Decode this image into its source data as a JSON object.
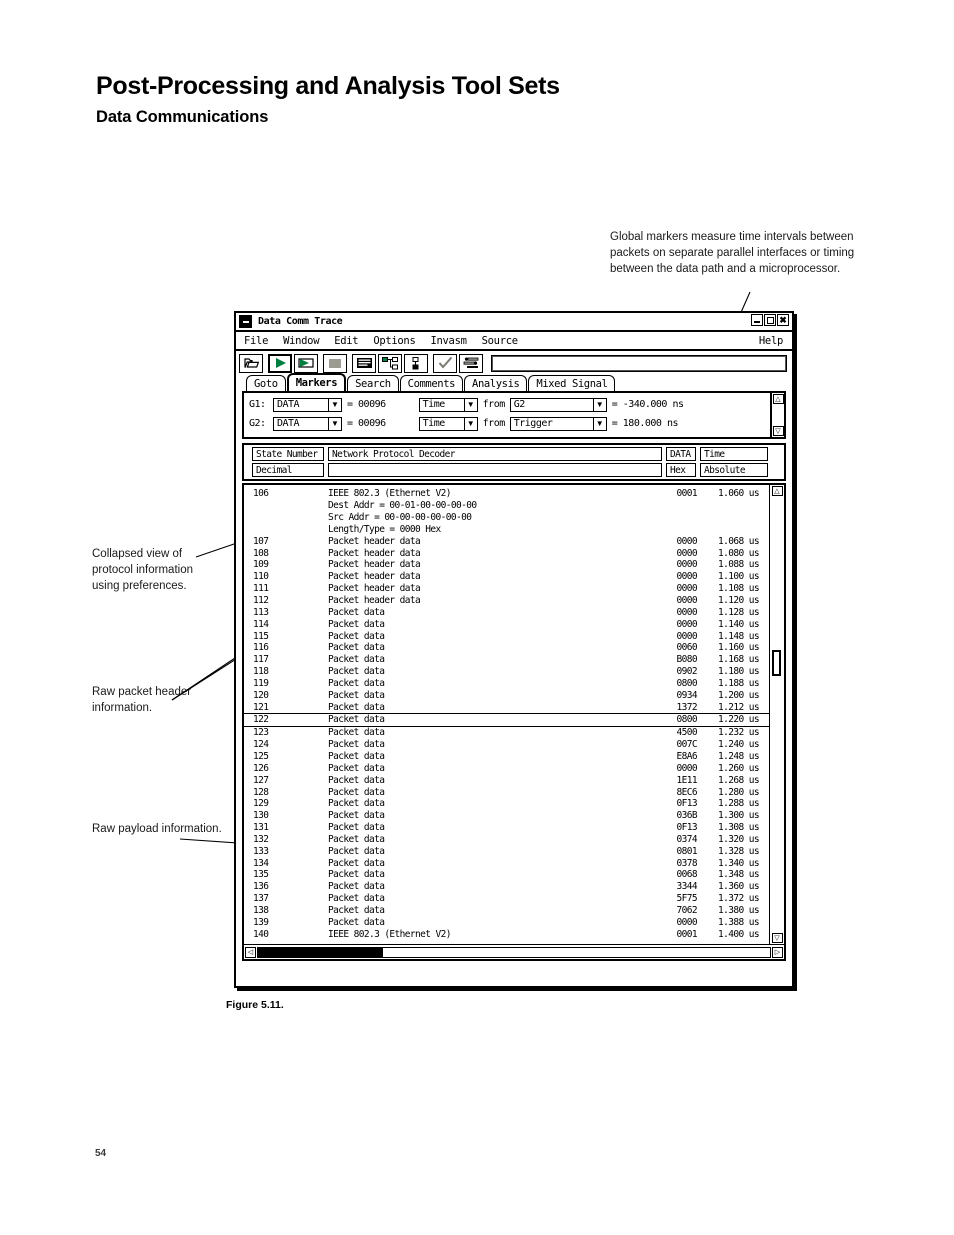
{
  "page": {
    "title": "Post-Processing and Analysis Tool Sets",
    "subtitle": "Data Communications",
    "figure_caption": "Figure 5.11.",
    "page_number": "54"
  },
  "callouts": {
    "global_markers": "Global markers measure time intervals between packets on separate parallel interfaces or timing between the data path and a microprocessor.",
    "collapsed_view": "Collapsed view of protocol information using preferences.",
    "raw_header": "Raw packet header information.",
    "raw_payload": "Raw payload information."
  },
  "window": {
    "title": "Data Comm Trace",
    "menus": [
      "File",
      "Window",
      "Edit",
      "Options",
      "Invasm",
      "Source"
    ],
    "help_label": "Help",
    "title_buttons": [
      "minimize-button",
      "maximize-button",
      "close-button"
    ],
    "toolbar_icons": [
      "open-folder-icon",
      "run-icon",
      "run-repetitive-icon",
      "stop-icon",
      "listing-icon",
      "network-tree-icon",
      "hierarchy-icon",
      "check-icon",
      "settings-sliders-icon"
    ],
    "toolbar_entry_value": ""
  },
  "tabs": [
    {
      "label": "Goto",
      "active": false
    },
    {
      "label": "Markers",
      "active": true
    },
    {
      "label": "Search",
      "active": false
    },
    {
      "label": "Comments",
      "active": false
    },
    {
      "label": "Analysis",
      "active": false
    },
    {
      "label": "Mixed Signal",
      "active": false
    }
  ],
  "markers": [
    {
      "name": "G1:",
      "pattern": "DATA",
      "equals_label": "= 00096",
      "measure": "Time",
      "from_label": "from",
      "reference": "G2",
      "result": "= -340.000 ns"
    },
    {
      "name": "G2:",
      "pattern": "DATA",
      "equals_label": "= 00096",
      "measure": "Time",
      "from_label": "from",
      "reference": "Trigger",
      "result": "= 180.000 ns"
    }
  ],
  "columns": {
    "state_number": "State Number",
    "state_base": "Decimal",
    "decoder": "Network Protocol Decoder",
    "decoder_sub": "",
    "data": "DATA",
    "data_base": "Hex",
    "time": "Time",
    "time_mode": "Absolute"
  },
  "trace_rows": [
    {
      "state": "106",
      "desc": "IEEE 802.3 (Ethernet V2)",
      "data": "0001",
      "time": "1.060 us",
      "sub": false,
      "marked": false
    },
    {
      "state": "",
      "desc": "Dest Addr = 00-01-00-00-00-00",
      "data": "",
      "time": "",
      "sub": true,
      "marked": false
    },
    {
      "state": "",
      "desc": "Src  Addr = 00-00-00-00-00-00",
      "data": "",
      "time": "",
      "sub": true,
      "marked": false
    },
    {
      "state": "",
      "desc": "Length/Type = 0000 Hex",
      "data": "",
      "time": "",
      "sub": true,
      "marked": false
    },
    {
      "state": "107",
      "desc": "Packet header data",
      "data": "0000",
      "time": "1.068 us",
      "sub": false,
      "marked": false
    },
    {
      "state": "108",
      "desc": "Packet header data",
      "data": "0000",
      "time": "1.080 us",
      "sub": false,
      "marked": false
    },
    {
      "state": "109",
      "desc": "Packet header data",
      "data": "0000",
      "time": "1.088 us",
      "sub": false,
      "marked": false
    },
    {
      "state": "110",
      "desc": "Packet header data",
      "data": "0000",
      "time": "1.100 us",
      "sub": false,
      "marked": false
    },
    {
      "state": "111",
      "desc": "Packet header data",
      "data": "0000",
      "time": "1.108 us",
      "sub": false,
      "marked": false
    },
    {
      "state": "112",
      "desc": "Packet header data",
      "data": "0000",
      "time": "1.120 us",
      "sub": false,
      "marked": false
    },
    {
      "state": "113",
      "desc": "Packet data",
      "data": "0000",
      "time": "1.128 us",
      "sub": false,
      "marked": false
    },
    {
      "state": "114",
      "desc": "Packet data",
      "data": "0000",
      "time": "1.140 us",
      "sub": false,
      "marked": false
    },
    {
      "state": "115",
      "desc": "Packet data",
      "data": "0000",
      "time": "1.148 us",
      "sub": false,
      "marked": false
    },
    {
      "state": "116",
      "desc": "Packet data",
      "data": "0060",
      "time": "1.160 us",
      "sub": false,
      "marked": false
    },
    {
      "state": "117",
      "desc": "Packet data",
      "data": "B080",
      "time": "1.168 us",
      "sub": false,
      "marked": false
    },
    {
      "state": "118",
      "desc": "Packet data",
      "data": "0902",
      "time": "1.180 us",
      "sub": false,
      "marked": false
    },
    {
      "state": "119",
      "desc": "Packet data",
      "data": "0800",
      "time": "1.188 us",
      "sub": false,
      "marked": false
    },
    {
      "state": "120",
      "desc": "Packet data",
      "data": "0934",
      "time": "1.200 us",
      "sub": false,
      "marked": false
    },
    {
      "state": "121",
      "desc": "Packet data",
      "data": "1372",
      "time": "1.212 us",
      "sub": false,
      "marked": false
    },
    {
      "state": "122",
      "desc": "Packet data",
      "data": "0800",
      "time": "1.220 us",
      "sub": false,
      "marked": true
    },
    {
      "state": "123",
      "desc": "Packet data",
      "data": "4500",
      "time": "1.232 us",
      "sub": false,
      "marked": false
    },
    {
      "state": "124",
      "desc": "Packet data",
      "data": "007C",
      "time": "1.240 us",
      "sub": false,
      "marked": false
    },
    {
      "state": "125",
      "desc": "Packet data",
      "data": "E8A6",
      "time": "1.248 us",
      "sub": false,
      "marked": false
    },
    {
      "state": "126",
      "desc": "Packet data",
      "data": "0000",
      "time": "1.260 us",
      "sub": false,
      "marked": false
    },
    {
      "state": "127",
      "desc": "Packet data",
      "data": "1E11",
      "time": "1.268 us",
      "sub": false,
      "marked": false
    },
    {
      "state": "128",
      "desc": "Packet data",
      "data": "8EC6",
      "time": "1.280 us",
      "sub": false,
      "marked": false
    },
    {
      "state": "129",
      "desc": "Packet data",
      "data": "0F13",
      "time": "1.288 us",
      "sub": false,
      "marked": false
    },
    {
      "state": "130",
      "desc": "Packet data",
      "data": "036B",
      "time": "1.300 us",
      "sub": false,
      "marked": false
    },
    {
      "state": "131",
      "desc": "Packet data",
      "data": "0F13",
      "time": "1.308 us",
      "sub": false,
      "marked": false
    },
    {
      "state": "132",
      "desc": "Packet data",
      "data": "0374",
      "time": "1.320 us",
      "sub": false,
      "marked": false
    },
    {
      "state": "133",
      "desc": "Packet data",
      "data": "0801",
      "time": "1.328 us",
      "sub": false,
      "marked": false
    },
    {
      "state": "134",
      "desc": "Packet data",
      "data": "0378",
      "time": "1.340 us",
      "sub": false,
      "marked": false
    },
    {
      "state": "135",
      "desc": "Packet data",
      "data": "0068",
      "time": "1.348 us",
      "sub": false,
      "marked": false
    },
    {
      "state": "136",
      "desc": "Packet data",
      "data": "3344",
      "time": "1.360 us",
      "sub": false,
      "marked": false
    },
    {
      "state": "137",
      "desc": "Packet data",
      "data": "5F75",
      "time": "1.372 us",
      "sub": false,
      "marked": false
    },
    {
      "state": "138",
      "desc": "Packet data",
      "data": "7062",
      "time": "1.380 us",
      "sub": false,
      "marked": false
    },
    {
      "state": "139",
      "desc": "Packet data",
      "data": "0000",
      "time": "1.388 us",
      "sub": false,
      "marked": false
    },
    {
      "state": "140",
      "desc": "IEEE 802.3 (Ethernet V2)",
      "data": "0001",
      "time": "1.400 us",
      "sub": false,
      "marked": false
    }
  ],
  "scrollbars": {
    "up_arrow": "△",
    "down_arrow": "▽",
    "left_arrow": "◁",
    "right_arrow": "▷"
  },
  "colors": {
    "accent_green": "#008040",
    "frame_black": "#000000",
    "paper_white": "#ffffff"
  }
}
